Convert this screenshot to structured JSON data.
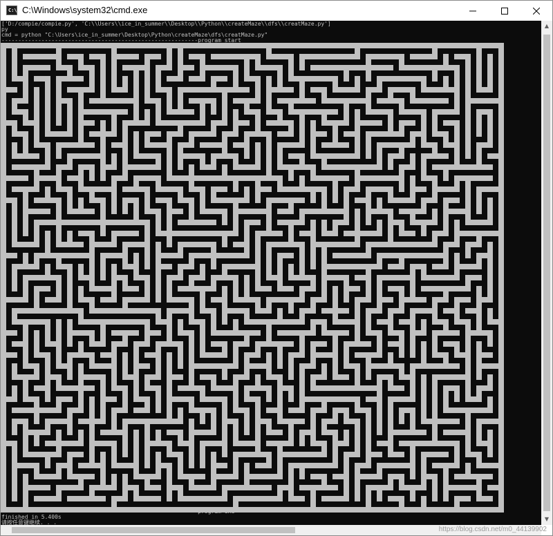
{
  "window": {
    "title": "C:\\Windows\\system32\\cmd.exe",
    "icon_text": "C:\\",
    "buttons": [
      "minimize-icon",
      "maximize-icon",
      "close-icon"
    ]
  },
  "console": {
    "text_color": "#c0c0c0",
    "background": "#0c0c0c",
    "lines_top": [
      "['D:/compie/compie.py', 'C:\\\\Users\\\\ice_in_summer\\\\Desktop\\\\Python\\\\createMaze\\\\dfs\\\\creatMaze.py']",
      "py",
      "cmd = python \"C:\\Users\\ice_in_summer\\Desktop\\Python\\createMaze\\dfs\\creatMaze.py\"",
      "-----------------------------------------------------------program start"
    ],
    "lines_bottom": [
      "-----------------------------------------------------------program end",
      "finished in 5.400s",
      "请按任意键继续. . ."
    ]
  },
  "maze": {
    "wall_color": "#c0c0c0",
    "path_color": "#0c0c0c"
  },
  "watermark": "https://blog.csdn.net/m0_44139902"
}
